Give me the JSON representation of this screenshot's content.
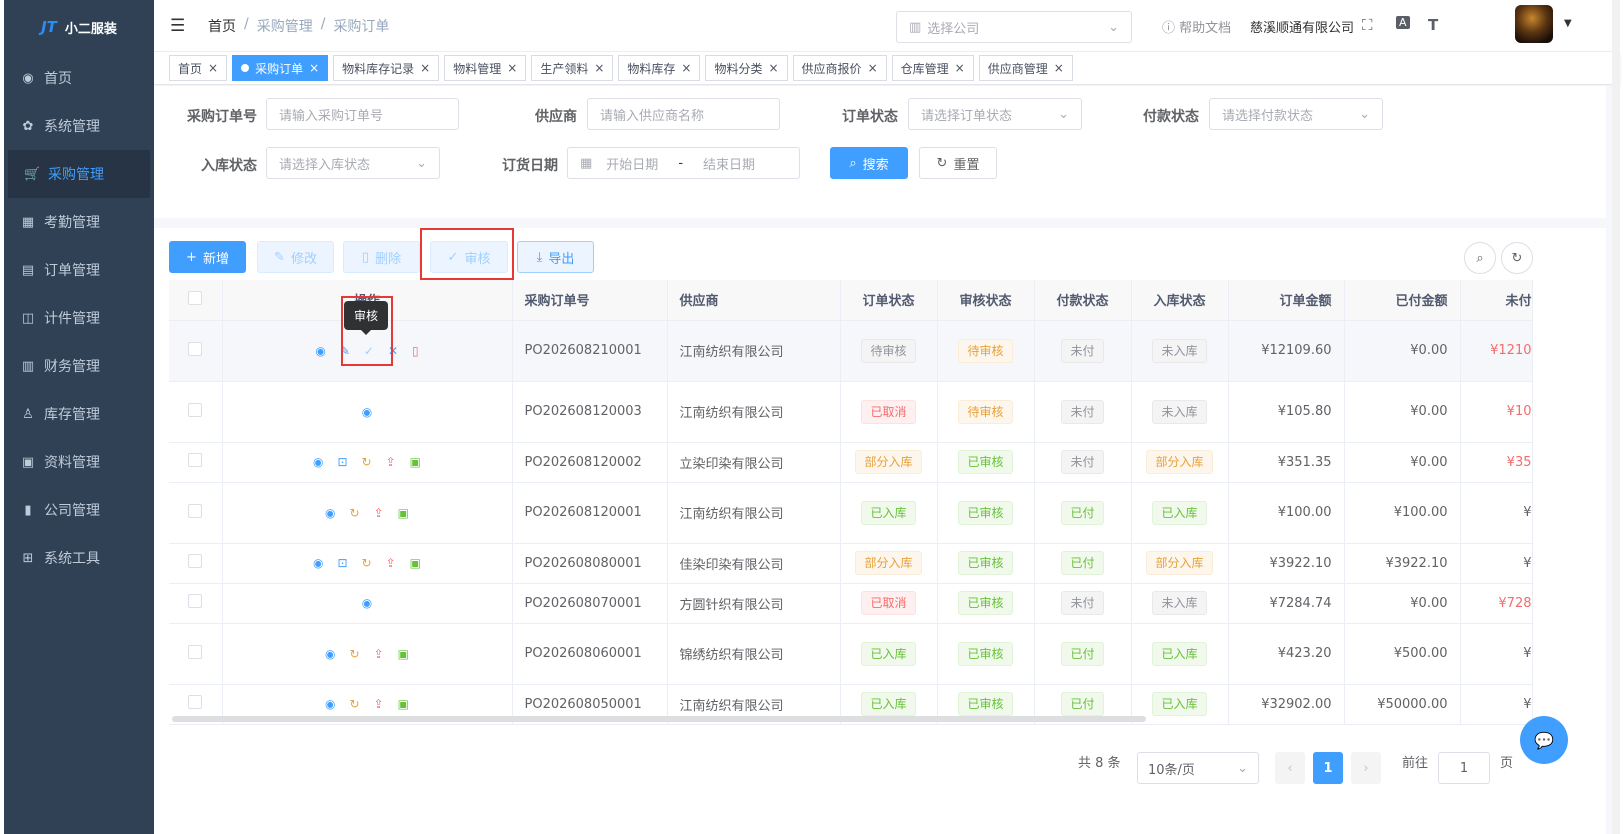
{
  "app": {
    "name": "小二服装",
    "logo_mark": "JT"
  },
  "sidebar": {
    "items": [
      {
        "icon": "dashboard-icon",
        "glyph": "◉",
        "label": "首页"
      },
      {
        "icon": "gear-icon",
        "glyph": "✿",
        "label": "系统管理"
      },
      {
        "icon": "cart-icon",
        "glyph": "🛒",
        "label": "采购管理",
        "active": true
      },
      {
        "icon": "grid-icon",
        "glyph": "▦",
        "label": "考勤管理"
      },
      {
        "icon": "order-icon",
        "glyph": "▤",
        "label": "订单管理"
      },
      {
        "icon": "book-icon",
        "glyph": "◫",
        "label": "计件管理"
      },
      {
        "icon": "chart-icon",
        "glyph": "▥",
        "label": "财务管理"
      },
      {
        "icon": "user-icon",
        "glyph": "♙",
        "label": "库存管理"
      },
      {
        "icon": "doc-icon",
        "glyph": "▣",
        "label": "资料管理"
      },
      {
        "icon": "bar-chart-icon",
        "glyph": "▮",
        "label": "公司管理"
      },
      {
        "icon": "toolbox-icon",
        "glyph": "⊞",
        "label": "系统工具"
      }
    ]
  },
  "header": {
    "breadcrumb": [
      "首页",
      "采购管理",
      "采购订单"
    ],
    "breadcrumb_sep": "/",
    "company_select_placeholder": "选择公司",
    "help": "帮助文档",
    "company": "慈溪顺通有限公司"
  },
  "tabs": [
    {
      "label": "首页"
    },
    {
      "label": "采购订单",
      "active": true
    },
    {
      "label": "物料库存记录"
    },
    {
      "label": "物料管理"
    },
    {
      "label": "生产领料"
    },
    {
      "label": "物料库存"
    },
    {
      "label": "物料分类"
    },
    {
      "label": "供应商报价"
    },
    {
      "label": "仓库管理"
    },
    {
      "label": "供应商管理"
    }
  ],
  "search": {
    "order_no_label": "采购订单号",
    "order_no_placeholder": "请输入采购订单号",
    "supplier_label": "供应商",
    "supplier_placeholder": "请输入供应商名称",
    "order_status_label": "订单状态",
    "order_status_placeholder": "请选择订单状态",
    "pay_status_label": "付款状态",
    "pay_status_placeholder": "请选择付款状态",
    "stock_status_label": "入库状态",
    "stock_status_placeholder": "请选择入库状态",
    "date_label": "订货日期",
    "date_start": "开始日期",
    "date_sep": "-",
    "date_end": "结束日期",
    "search_btn": "搜索",
    "reset_btn": "重置"
  },
  "toolbar": {
    "add": "新增",
    "edit": "修改",
    "delete": "删除",
    "audit": "审核",
    "export": "导出"
  },
  "tooltip": "审核",
  "table": {
    "headers": [
      "操作",
      "采购订单号",
      "供应商",
      "订单状态",
      "审核状态",
      "付款状态",
      "入库状态",
      "订单金额",
      "已付金额",
      "未付"
    ],
    "rows": [
      {
        "no": "PO202608210001",
        "supplier": "江南纺织有限公司",
        "status": "待审核",
        "status_t": "info",
        "audit": "待审核",
        "audit_t": "warn",
        "pay": "未付",
        "pay_t": "info",
        "stock": "未入库",
        "stock_t": "info",
        "amount": "¥12109.60",
        "paid": "¥0.00",
        "unpaid": "¥1210",
        "unpaid_red": true,
        "ops": "audit"
      },
      {
        "no": "PO202608120003",
        "supplier": "江南纺织有限公司",
        "status": "已取消",
        "status_t": "danger",
        "audit": "待审核",
        "audit_t": "warn",
        "pay": "未付",
        "pay_t": "info",
        "stock": "未入库",
        "stock_t": "info",
        "amount": "¥105.80",
        "paid": "¥0.00",
        "unpaid": "¥10",
        "unpaid_red": true,
        "ops": "view"
      },
      {
        "no": "PO202608120002",
        "supplier": "立染印染有限公司",
        "status": "部分入库",
        "status_t": "warn",
        "audit": "已审核",
        "audit_t": "success",
        "pay": "未付",
        "pay_t": "info",
        "stock": "部分入库",
        "stock_t": "warn",
        "amount": "¥351.35",
        "paid": "¥0.00",
        "unpaid": "¥35",
        "unpaid_red": true,
        "ops": "full"
      },
      {
        "no": "PO202608120001",
        "supplier": "江南纺织有限公司",
        "status": "已入库",
        "status_t": "success",
        "audit": "已审核",
        "audit_t": "success",
        "pay": "已付",
        "pay_t": "success",
        "stock": "已入库",
        "stock_t": "success",
        "amount": "¥100.00",
        "paid": "¥100.00",
        "unpaid": "¥",
        "unpaid_red": false,
        "ops": "done"
      },
      {
        "no": "PO202608080001",
        "supplier": "佳染印染有限公司",
        "status": "部分入库",
        "status_t": "warn",
        "audit": "已审核",
        "audit_t": "success",
        "pay": "已付",
        "pay_t": "success",
        "stock": "部分入库",
        "stock_t": "warn",
        "amount": "¥3922.10",
        "paid": "¥3922.10",
        "unpaid": "¥",
        "unpaid_red": false,
        "ops": "full"
      },
      {
        "no": "PO202608070001",
        "supplier": "方圆针织有限公司",
        "status": "已取消",
        "status_t": "danger",
        "audit": "已审核",
        "audit_t": "success",
        "pay": "未付",
        "pay_t": "info",
        "stock": "未入库",
        "stock_t": "info",
        "amount": "¥7284.74",
        "paid": "¥0.00",
        "unpaid": "¥728",
        "unpaid_red": true,
        "ops": "view"
      },
      {
        "no": "PO202608060001",
        "supplier": "锦绣纺织有限公司",
        "status": "已入库",
        "status_t": "success",
        "audit": "已审核",
        "audit_t": "success",
        "pay": "已付",
        "pay_t": "success",
        "stock": "已入库",
        "stock_t": "success",
        "amount": "¥423.20",
        "paid": "¥500.00",
        "unpaid": "¥",
        "unpaid_red": false,
        "ops": "done"
      },
      {
        "no": "PO202608050001",
        "supplier": "江南纺织有限公司",
        "status": "已入库",
        "status_t": "success",
        "audit": "已审核",
        "audit_t": "success",
        "pay": "已付",
        "pay_t": "success",
        "stock": "已入库",
        "stock_t": "success",
        "amount": "¥32902.00",
        "paid": "¥50000.00",
        "unpaid": "¥",
        "unpaid_red": false,
        "ops": "done"
      }
    ]
  },
  "pagination": {
    "total": "共 8 条",
    "page_size": "10条/页",
    "prev": "‹",
    "next": "›",
    "current": "1",
    "goto": "前往",
    "goto_value": "1",
    "page_unit": "页"
  },
  "colors": {
    "primary": "#409eff",
    "sidebar_bg": "#304156",
    "danger": "#f56c6c",
    "highlight_box": "#e53935"
  }
}
